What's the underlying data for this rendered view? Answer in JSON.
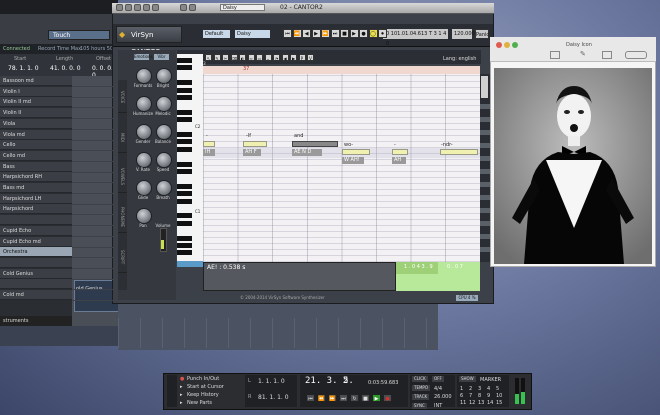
{
  "daw": {
    "toolbar": {
      "touch_label": "Touch"
    },
    "header": {
      "connected": "Connected",
      "record_time": "Record Time Max",
      "record_time_value": "105 hours 50 mins"
    },
    "cols": {
      "start": "Start",
      "length": "Length",
      "offset": "Offset",
      "start_val": "78. 1. 1. 0",
      "length_val": "41. 0. 0. 0",
      "offset_val": "0. 0. 0. 0"
    },
    "tracks": [
      "Bassoon md",
      "Violin I",
      "Violin II md",
      "Violin II",
      "Viola",
      "Viola md",
      "Cello",
      "Cello md",
      "Bass",
      "Harpsichord RH",
      "Bass md",
      "Harpsichord LH",
      "Harpsichord",
      "",
      "Cupid Echo",
      "Cupid Echo md",
      "Orchestra",
      "",
      "Cold Genius",
      "",
      "Cold md"
    ],
    "selected_track": "Orchestra",
    "clip_label": "old Genius",
    "bottom_label": "struments"
  },
  "cantor": {
    "window_title": "02 - CANTOR2",
    "preset_dropdown": "Daisy",
    "brand": "VirSyn CANTOR",
    "preset_field": "Default",
    "voice_field": "Daisy",
    "transport_buttons": [
      "⏮",
      "⏪",
      "◀",
      "▶",
      "⏩",
      "⏭",
      "■",
      "▶",
      "●",
      "◯",
      "⏺"
    ],
    "position_display": "0  101.01.04.613   T 3 1 4   0",
    "tempo_display": "120.000",
    "panic_label": "Panic",
    "side_tabs": [
      "VOICE",
      "MIDI",
      "VOWELS",
      "PHONEME",
      "SCRIPT"
    ],
    "lcd1": "Emotions",
    "lcd2": "Vibr",
    "knobs": [
      {
        "label": "Formants"
      },
      {
        "label": "Bright"
      },
      {
        "label": "Humanize"
      },
      {
        "label": "Melodic"
      },
      {
        "label": "Gender"
      },
      {
        "label": "Balance"
      },
      {
        "label": "V. Rate"
      },
      {
        "label": "Speed"
      },
      {
        "label": "Glide"
      },
      {
        "label": "Breath"
      },
      {
        "label": "Pan"
      },
      {
        "label": "Volume"
      }
    ],
    "volume_level": 0.45,
    "position_label": "A1",
    "position_value": "37.01.04.613",
    "octave_labels": [
      "C2",
      "C1"
    ],
    "tools": [
      "↖",
      "✎",
      "✂",
      "⌫",
      "◐",
      "≈",
      "▭",
      "⌄",
      "◔",
      "◀",
      "▶",
      "P",
      "V"
    ],
    "language": "Lang: english",
    "bars": [
      "37",
      "",
      "",
      "",
      "",
      "",
      "",
      ""
    ],
    "lyrics": [
      "-",
      "-lf",
      "and",
      "wo-",
      "-",
      "-ndr-"
    ],
    "phonemes": [
      "IH",
      "AH F",
      "AE N D",
      "W AH!",
      "AH"
    ],
    "info_text": "AE! : 0.538 s",
    "green_val1": "1 . 0 4 3 . 9",
    "green_val2": "0 . 0 7",
    "copyright": "© 2004-2014 VirSyn Software Synthesizer",
    "cpu": "CPU 4 %"
  },
  "viewer": {
    "title": "Daisy Icon"
  },
  "transport": {
    "punch_in": "Punch In/Out",
    "start_at_cursor": "Start at Cursor",
    "keep_history": "Keep History",
    "new_parts": "New Parts",
    "left_locator": "1. 1. 1. 0",
    "right_locator": "81. 1. 1. 0",
    "position_bars": "21. 3. 2.",
    "position_tick": "5",
    "time_display": "0:03:59.683",
    "click_label": "CLICK",
    "click_state": "OFF",
    "tempo_label": "TEMPO",
    "track_label": "TRACK",
    "sync_label": "SYNC",
    "tempo_value": "4/4",
    "bpm_value": "26.000",
    "sync_value": "INT",
    "show_label": "SHOW",
    "marker_label": "MARKER",
    "markers": [
      "1",
      "2",
      "3",
      "4",
      "5",
      "6",
      "7",
      "8",
      "9",
      "10",
      "11",
      "12",
      "13",
      "14",
      "15"
    ]
  }
}
